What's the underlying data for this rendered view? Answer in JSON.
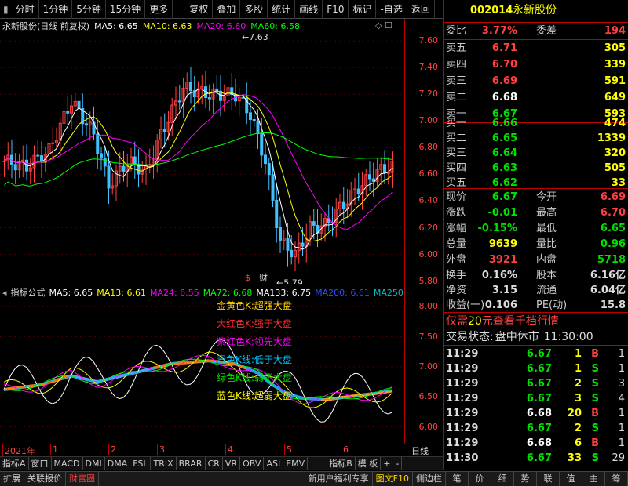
{
  "toolbar": {
    "period_tabs": [
      "分时",
      "1分钟",
      "5分钟",
      "15分钟",
      "更多"
    ],
    "actions": [
      "复权",
      "叠加",
      "多股",
      "统计",
      "画线",
      "F10",
      "标记",
      "-自选",
      "返回"
    ]
  },
  "main_chart": {
    "title": "永新股份(日线 前复权)",
    "ma": [
      {
        "label": "MA5: 6.65",
        "color": "#ffffff"
      },
      {
        "label": "MA10: 6.63",
        "color": "#ffff00"
      },
      {
        "label": "MA20: 6.60",
        "color": "#ff00ff"
      },
      {
        "label": "MA60: 6.58",
        "color": "#00ff00"
      }
    ],
    "y_ticks": [
      "7.60",
      "7.40",
      "7.20",
      "7.00",
      "6.80",
      "6.60",
      "6.40",
      "6.20",
      "6.00",
      "5.80"
    ],
    "high_marker": "7.63",
    "low_marker": "5.79",
    "event_icons": [
      "$",
      "财"
    ]
  },
  "sub_chart": {
    "title": "指标公式",
    "ma": [
      {
        "label": "MA5: 6.65",
        "color": "#ffffff"
      },
      {
        "label": "MA13: 6.61",
        "color": "#ffff00"
      },
      {
        "label": "MA24: 6.55",
        "color": "#ff00ff"
      },
      {
        "label": "MA72: 6.68",
        "color": "#00ff00"
      },
      {
        "label": "MA133: 6.75",
        "color": "#ffffff"
      },
      {
        "label": "MA200: 6.61",
        "color": "#3050ff"
      },
      {
        "label": "MA250:",
        "color": "#00c0c0"
      }
    ],
    "y_ticks": [
      "8.00",
      "7.50",
      "7.00",
      "6.50",
      "6.00"
    ],
    "legend": [
      {
        "text": "金黄色K:超强大盘",
        "color": "#ffd700"
      },
      {
        "text": "大红色K:强于大盘",
        "color": "#ff3030"
      },
      {
        "text": "紫红色K:领先大盘",
        "color": "#ff00ff"
      },
      {
        "text": "青色K线:低于大盘",
        "color": "#00c8ff"
      },
      {
        "text": "绿色K线:弱于大盘",
        "color": "#00e000"
      },
      {
        "text": "蓝色K线:超弱大盘",
        "color": "#ffff00"
      }
    ]
  },
  "date_axis": {
    "labels": [
      "2021年",
      "1",
      "2",
      "3",
      "4",
      "5",
      "6"
    ],
    "right_label": "日线"
  },
  "indicator_tabs": [
    "指标A",
    "窗口",
    "MACD",
    "DMI",
    "DMA",
    "FSL",
    "TRIX",
    "BRAR",
    "CR",
    "VR",
    "OBV",
    "ASI",
    "EMV",
    "指标B",
    "模 板",
    "+",
    "-"
  ],
  "bottom_tabs": [
    "扩展",
    "关联报价",
    "财富圈"
  ],
  "bottom_right": [
    "新用户福利专享",
    "图文F10",
    "侧边栏",
    "笔",
    "价",
    "细",
    "势",
    "联",
    "值",
    "主",
    "筹"
  ],
  "quote": {
    "code": "002014",
    "name": "永新股份",
    "weibi_label": "委比",
    "weibi": "3.77%",
    "weicha_label": "委差",
    "weicha": "194",
    "asks": [
      {
        "label": "卖五",
        "price": "6.71",
        "vol": "305",
        "color": "#ff4040"
      },
      {
        "label": "卖四",
        "price": "6.70",
        "vol": "339",
        "color": "#ff4040"
      },
      {
        "label": "卖三",
        "price": "6.69",
        "vol": "591",
        "color": "#ff4040"
      },
      {
        "label": "卖二",
        "price": "6.68",
        "vol": "649",
        "color": "#ffffff"
      },
      {
        "label": "卖一",
        "price": "6.67",
        "vol": "593",
        "color": "#00e000"
      }
    ],
    "bids": [
      {
        "label": "买一",
        "price": "6.66",
        "vol": "474",
        "color": "#00e000"
      },
      {
        "label": "买二",
        "price": "6.65",
        "vol": "1339",
        "color": "#00e000"
      },
      {
        "label": "买三",
        "price": "6.64",
        "vol": "320",
        "color": "#00e000"
      },
      {
        "label": "买四",
        "price": "6.63",
        "vol": "505",
        "color": "#00e000"
      },
      {
        "label": "买五",
        "price": "6.62",
        "vol": "33",
        "color": "#00e000"
      }
    ],
    "stats": [
      {
        "l1": "现价",
        "v1": "6.67",
        "c1": "#00e000",
        "l2": "今开",
        "v2": "6.69",
        "c2": "#ff4040"
      },
      {
        "l1": "涨跌",
        "v1": "-0.01",
        "c1": "#00e000",
        "l2": "最高",
        "v2": "6.70",
        "c2": "#ff4040"
      },
      {
        "l1": "涨幅",
        "v1": "-0.15%",
        "c1": "#00e000",
        "l2": "最低",
        "v2": "6.65",
        "c2": "#00e000"
      },
      {
        "l1": "总量",
        "v1": "9639",
        "c1": "#ffff00",
        "l2": "量比",
        "v2": "0.96",
        "c2": "#00e000"
      },
      {
        "l1": "外盘",
        "v1": "3921",
        "c1": "#ff4040",
        "l2": "内盘",
        "v2": "5718",
        "c2": "#00e000"
      }
    ],
    "stats2": [
      {
        "l1": "换手",
        "v1": "0.16%",
        "l2": "股本",
        "v2": "6.16亿"
      },
      {
        "l1": "净资",
        "v1": "3.15",
        "l2": "流通",
        "v2": "6.04亿"
      },
      {
        "l1": "收益(一)",
        "v1": "0.106",
        "l2": "PE(动)",
        "v2": "15.8"
      }
    ],
    "promo": "仅需20元查看千档行情",
    "promo_prefix": "仅需",
    "promo_amount": "20",
    "promo_suffix": "元查看千档行情",
    "status_label": "交易状态:",
    "status": "盘中休市",
    "status_time": "11:30:00"
  },
  "ticks": [
    {
      "time": "11:29",
      "price": "6.67",
      "pc": "#00e000",
      "vol": "1",
      "side": "B",
      "sc": "#ff4040",
      "cnt": "1"
    },
    {
      "time": "11:29",
      "price": "6.67",
      "pc": "#00e000",
      "vol": "1",
      "side": "S",
      "sc": "#00e000",
      "cnt": "1"
    },
    {
      "time": "11:29",
      "price": "6.67",
      "pc": "#00e000",
      "vol": "2",
      "side": "S",
      "sc": "#00e000",
      "cnt": "3"
    },
    {
      "time": "11:29",
      "price": "6.67",
      "pc": "#00e000",
      "vol": "3",
      "side": "S",
      "sc": "#00e000",
      "cnt": "4"
    },
    {
      "time": "11:29",
      "price": "6.68",
      "pc": "#ffffff",
      "vol": "20",
      "side": "B",
      "sc": "#ff4040",
      "cnt": "1"
    },
    {
      "time": "11:29",
      "price": "6.67",
      "pc": "#00e000",
      "vol": "2",
      "side": "S",
      "sc": "#00e000",
      "cnt": "1"
    },
    {
      "time": "11:29",
      "price": "6.68",
      "pc": "#ffffff",
      "vol": "6",
      "side": "B",
      "sc": "#ff4040",
      "cnt": "1"
    },
    {
      "time": "11:30",
      "price": "6.67",
      "pc": "#00e000",
      "vol": "33",
      "side": "S",
      "sc": "#00e000",
      "cnt": "29"
    }
  ]
}
